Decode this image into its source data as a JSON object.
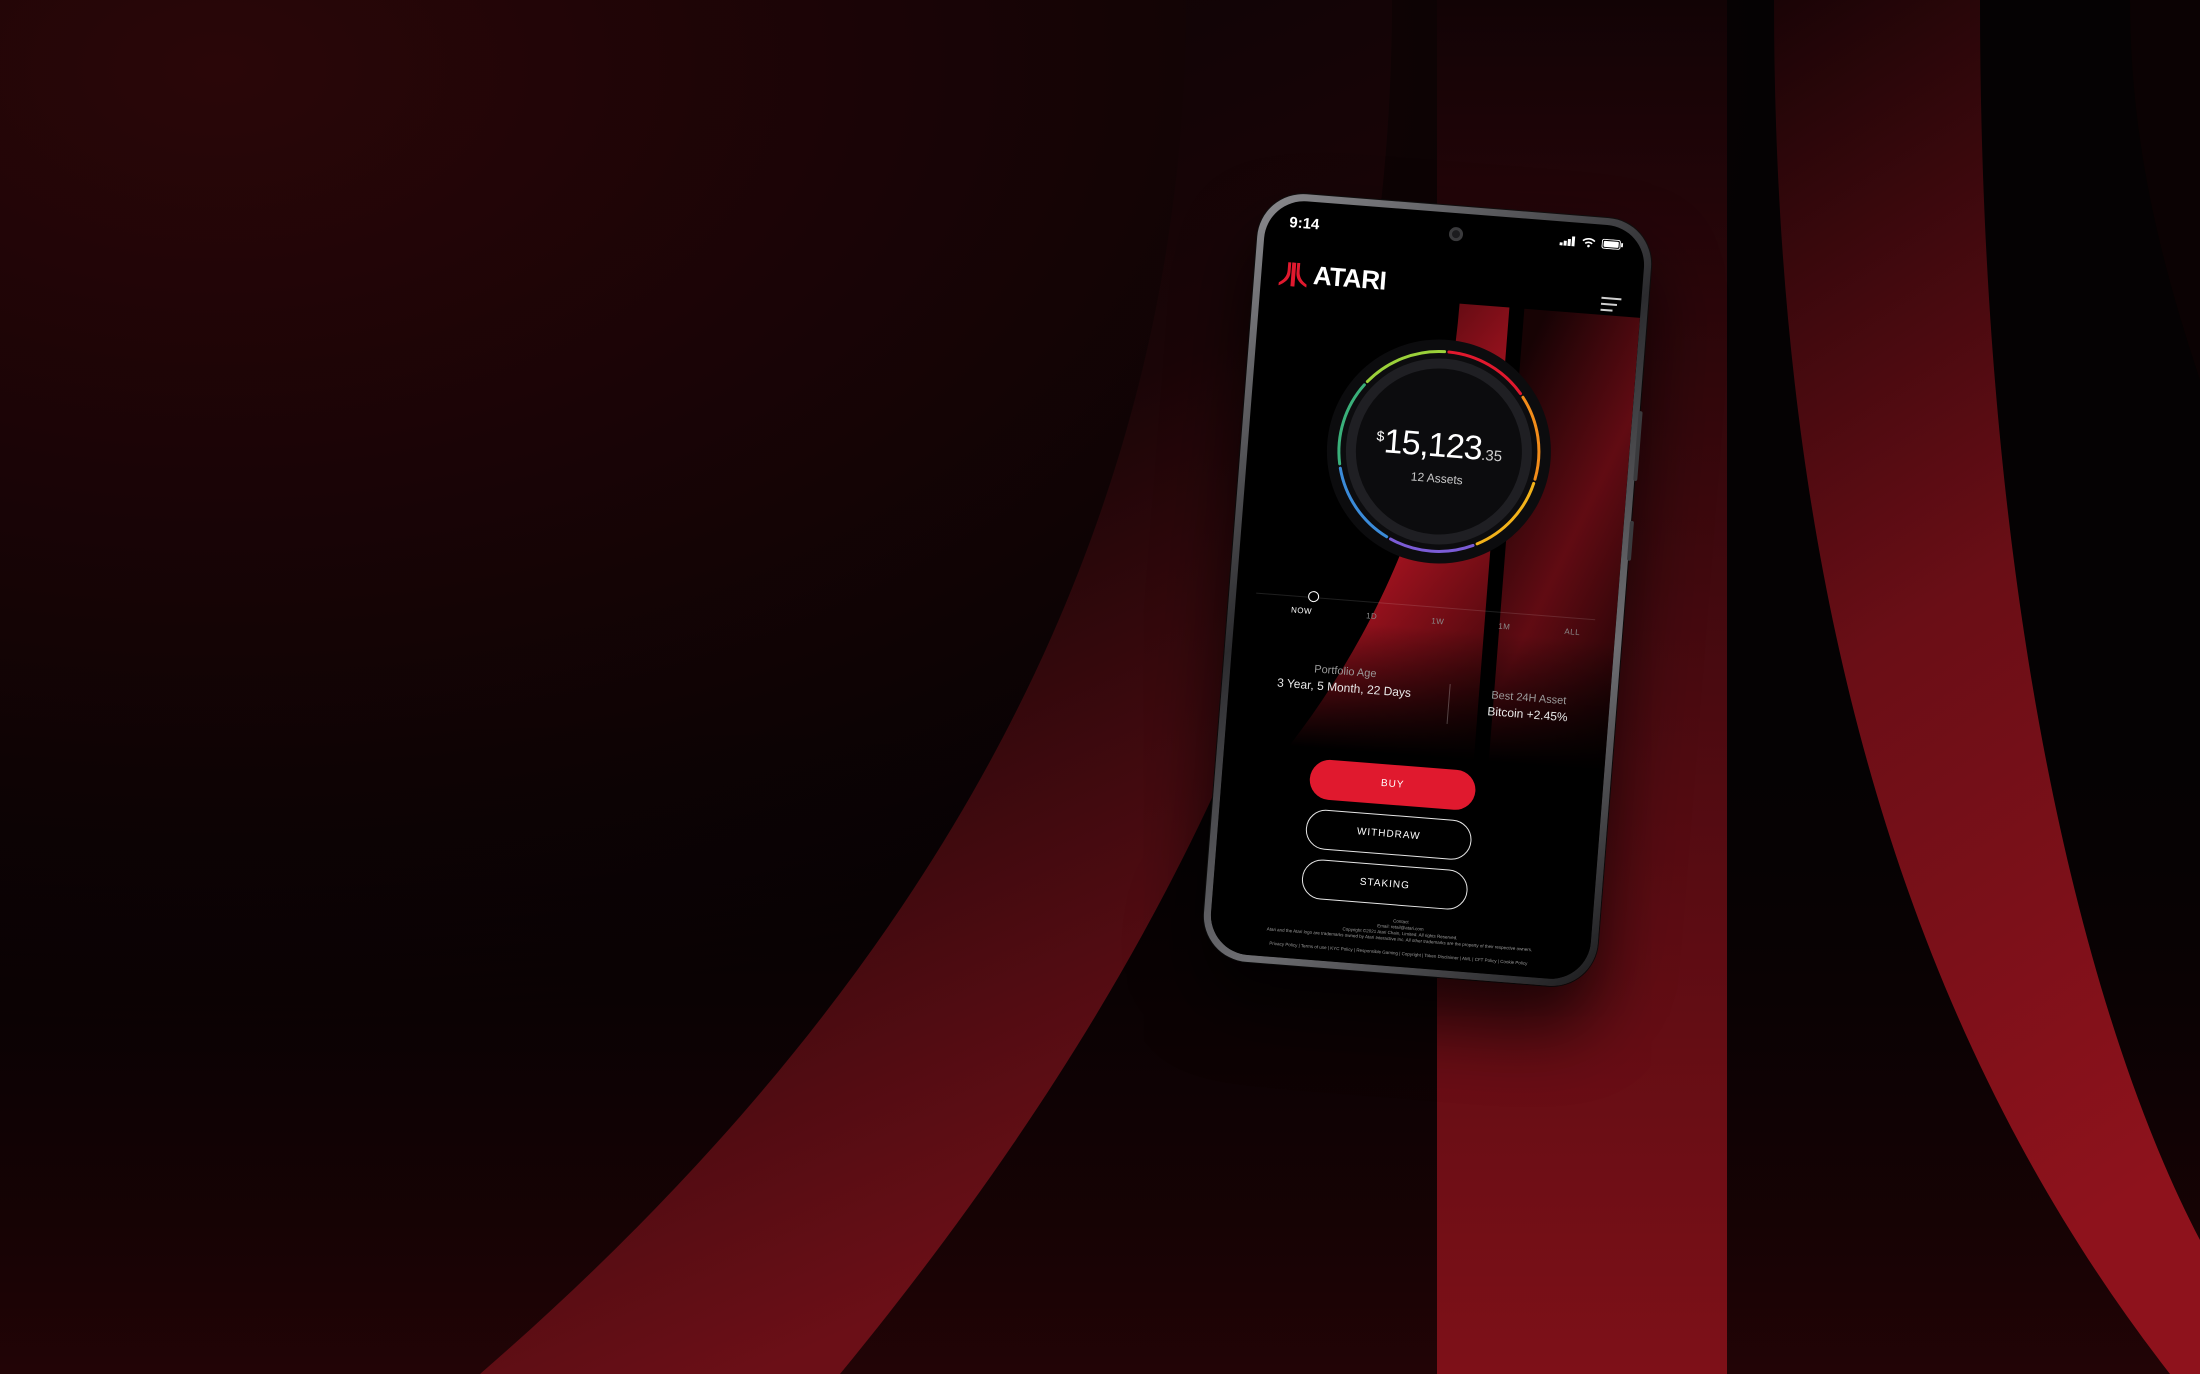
{
  "phone": {
    "status": {
      "time": "9:14"
    },
    "header": {
      "brand": "ATARI"
    },
    "portfolio": {
      "currency_symbol": "$",
      "balance_main": "15,123",
      "balance_cents": ".35",
      "assets_label": "12 Assets",
      "ring_colors": [
        "#e0192e",
        "#f28c1a",
        "#f2b21a",
        "#7b5cd6",
        "#3b8bd9",
        "#3ab07a",
        "#9bd13a"
      ]
    },
    "timeline": {
      "labels": [
        "NOW",
        "1D",
        "1W",
        "1M",
        "ALL"
      ],
      "selected": "NOW"
    },
    "stats": {
      "age_label": "Portfolio Age",
      "age_value": "3 Year, 5 Month, 22 Days",
      "best_label": "Best 24H Asset",
      "best_value": "Bitcoin +2.45%"
    },
    "actions": {
      "buy": "BUY",
      "withdraw": "WITHDRAW",
      "staking": "STAKING"
    },
    "footer": {
      "contact": "Contact",
      "email": "Email: retail@atari.com",
      "copyright": "Copyright ©2021 Atari Chain, Limited. All rights Reserved.",
      "trademark": "Atari and the Atari logo are trademarks owned by Atari Interactive Inc. All other trademarks are the property of their respective owners.",
      "links": "Privacy Policy  |  Terms of use  |  KYC Policy  |  Responsible Gaming  |  Copyright  |  Token Disclaimer  |  AML  |  CFT Policy  |  Cookie Policy"
    }
  }
}
